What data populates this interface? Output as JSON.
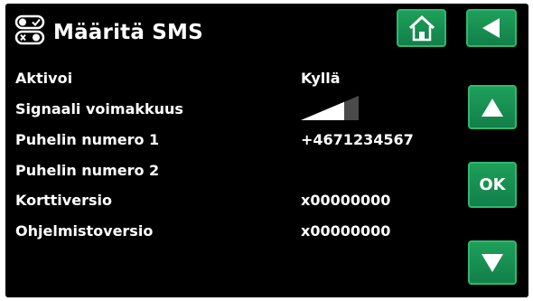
{
  "header": {
    "title": "Määritä SMS",
    "icon": "toggle-switches-icon"
  },
  "nav": {
    "home_icon": "home-icon",
    "back_icon": "back-arrow-icon"
  },
  "side_buttons": {
    "up_icon": "arrow-up-icon",
    "ok_label": "OK",
    "down_icon": "arrow-down-icon"
  },
  "rows": [
    {
      "label": "Aktivoi",
      "value": "Kyllä"
    },
    {
      "label": "Signaali voimakkuus",
      "value": "",
      "icon": "signal-strength-icon",
      "signal_level": 0.75
    },
    {
      "label": "Puhelin numero 1",
      "value": "+4671234567"
    },
    {
      "label": "Puhelin numero 2",
      "value": ""
    },
    {
      "label": "Korttiversio",
      "value": "x00000000"
    },
    {
      "label": "Ohjelmistoversio",
      "value": "x00000000"
    }
  ],
  "colors": {
    "background": "#000000",
    "button": "#17904f",
    "text": "#ffffff"
  }
}
